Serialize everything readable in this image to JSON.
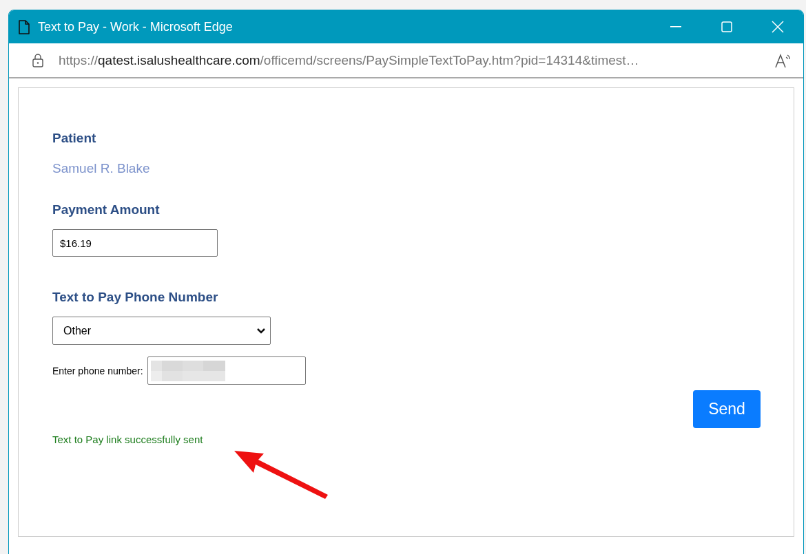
{
  "window": {
    "title": "Text to Pay - Work - Microsoft Edge"
  },
  "address_bar": {
    "scheme": "https://",
    "domain": "qatest.isalushealthcare.com",
    "path": "/officemd/screens/PaySimpleTextToPay.htm?pid=14314&timest…"
  },
  "form": {
    "patient_label": "Patient",
    "patient_name": "Samuel R. Blake",
    "amount_label": "Payment Amount",
    "amount_value": "$16.19",
    "phone_label": "Text to Pay Phone Number",
    "phone_select": "Other",
    "phone_entry_label": "Enter phone number:",
    "send_button": "Send",
    "status_message": "Text to Pay link successfully sent"
  }
}
